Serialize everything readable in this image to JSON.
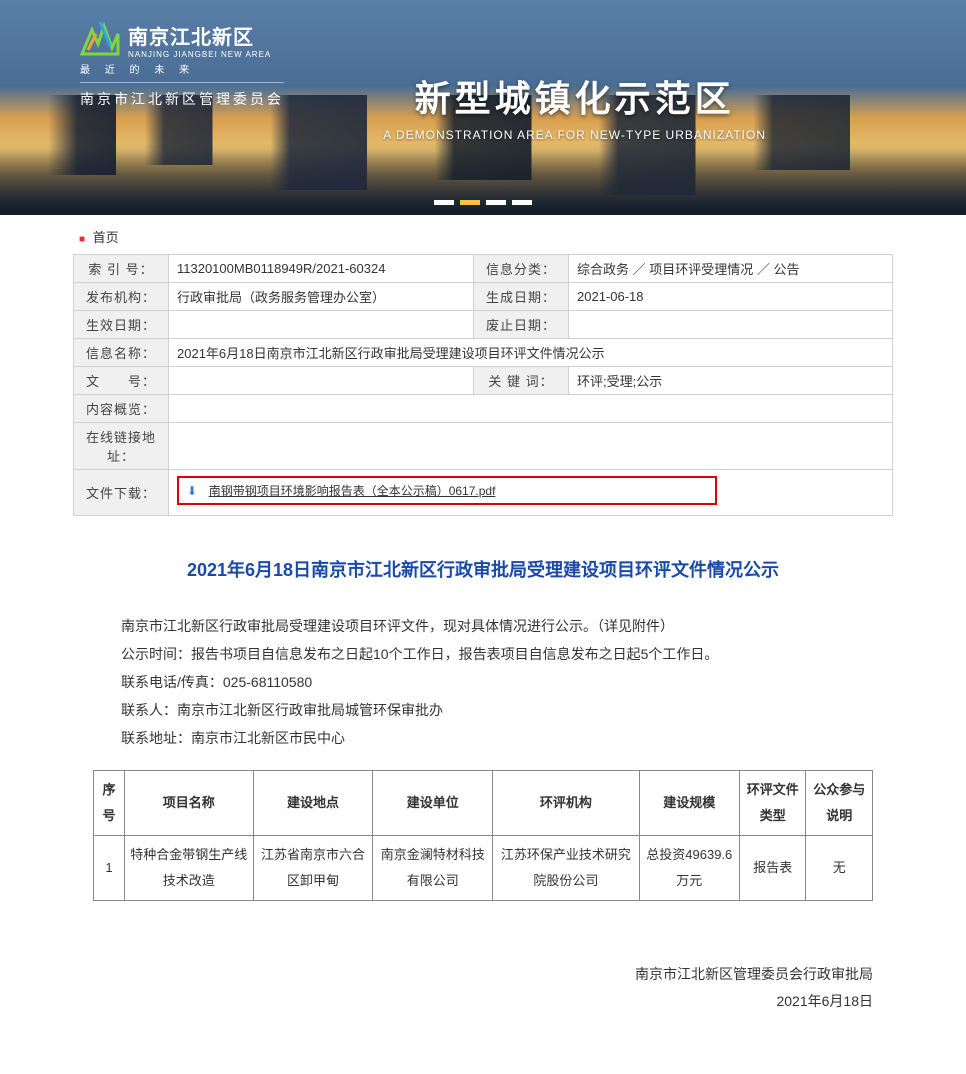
{
  "banner": {
    "logo_cn": "南京江北新区",
    "logo_en": "NANJING JIANGBEI NEW AREA",
    "logo_sub": "最 近 的 未 来",
    "committee": "南京市江北新区管理委员会",
    "title": "新型城镇化示范区",
    "subtitle": "A DEMONSTRATION AREA FOR NEW-TYPE URBANIZATION"
  },
  "crumb": {
    "home": "首页"
  },
  "meta": {
    "r1": {
      "l1": "索 引 号：",
      "v1": "11320100MB0118949R/2021-60324",
      "l2": "信息分类：",
      "v2": "综合政务 ／ 项目环评受理情况 ／ 公告"
    },
    "r2": {
      "l1": "发布机构：",
      "v1": "行政审批局（政务服务管理办公室）",
      "l2": "生成日期：",
      "v2": "2021-06-18"
    },
    "r3": {
      "l1": "生效日期：",
      "v1": "",
      "l2": "废止日期：",
      "v2": ""
    },
    "r4": {
      "l1": "信息名称：",
      "v1": "2021年6月18日南京市江北新区行政审批局受理建设项目环评文件情况公示"
    },
    "r5": {
      "l1": "文　　号：",
      "v1": "",
      "l2": "关 键 词：",
      "v2": "环评;受理;公示"
    },
    "r6": {
      "l1": "内容概览：",
      "v1": ""
    },
    "r7": {
      "l1": "在线链接地址：",
      "v1": ""
    },
    "r8": {
      "l1": "文件下载：",
      "link": "南钢带钢项目环境影响报告表（全本公示稿）0617.pdf"
    }
  },
  "article": {
    "title": "2021年6月18日南京市江北新区行政审批局受理建设项目环评文件情况公示",
    "p1": "南京市江北新区行政审批局受理建设项目环评文件，现对具体情况进行公示。（详见附件）",
    "p2": "公示时间：报告书项目自信息发布之日起10个工作日，报告表项目自信息发布之日起5个工作日。",
    "p3": "联系电话/传真：025-68110580",
    "p4": "联系人：南京市江北新区行政审批局城管环保审批办",
    "p5": "联系地址：南京市江北新区市民中心",
    "headers": {
      "c0": "序号",
      "c1": "项目名称",
      "c2": "建设地点",
      "c3": "建设单位",
      "c4": "环评机构",
      "c5": "建设规模",
      "c6": "环评文件类型",
      "c7": "公众参与说明"
    },
    "row": {
      "c0": "1",
      "c1": "特种合金带钢生产线技术改造",
      "c2": "江苏省南京市六合区卸甲甸",
      "c3": "南京金澜特材科技有限公司",
      "c4": "江苏环保产业技术研究院股份公司",
      "c5": "总投资49639.6万元",
      "c6": "报告表",
      "c7": "无"
    },
    "sign1": "南京市江北新区管理委员会行政审批局",
    "sign2": "2021年6月18日"
  }
}
